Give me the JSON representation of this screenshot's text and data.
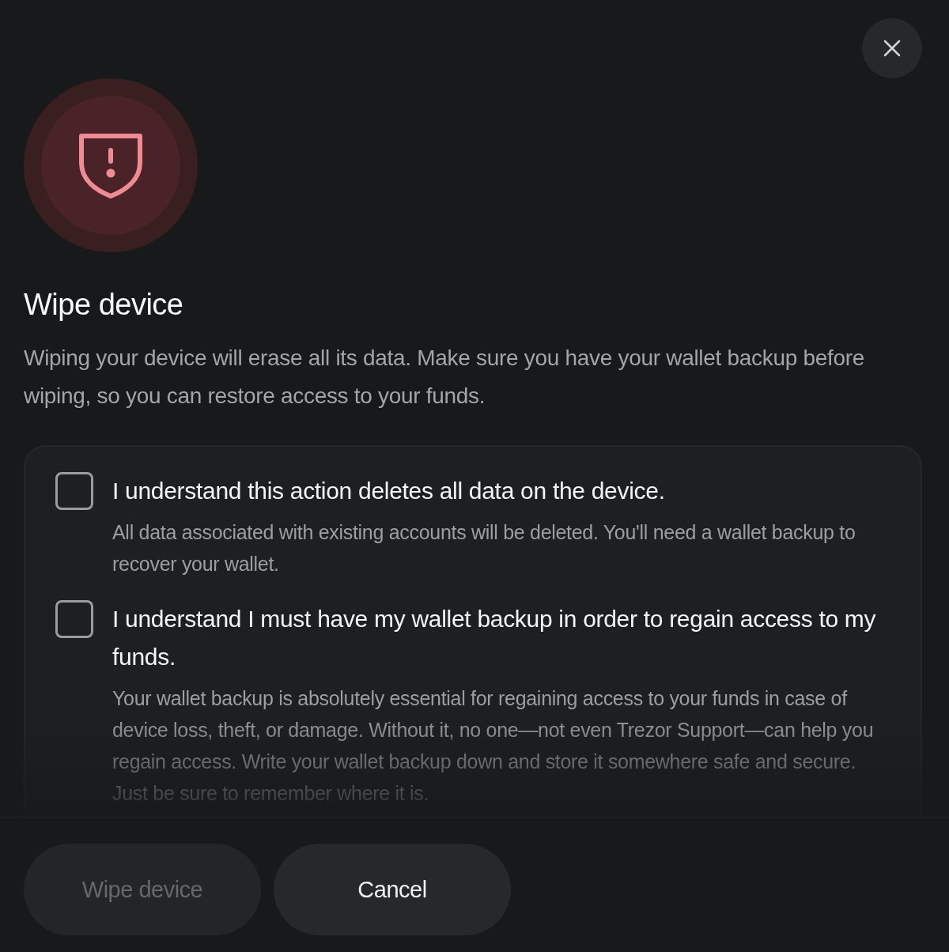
{
  "title": "Wipe device",
  "description": "Wiping your device will erase all its data. Make sure you have your wallet backup before wiping, so you can restore access to your funds.",
  "checks": [
    {
      "label": "I understand this action deletes all data on the device.",
      "detail": "All data associated with existing accounts will be deleted. You'll need a wallet backup to recover your wallet.",
      "checked": false
    },
    {
      "label": "I understand I must have my wallet backup in order to regain access to my funds.",
      "detail": "Your wallet backup is absolutely essential for regaining access to your funds in case of device loss, theft, or damage. Without it, no one—not even Trezor Support—can help you regain access. Write your wallet backup down and store it somewhere safe and secure. Just be sure to remember where it is.",
      "checked": false
    }
  ],
  "buttons": [
    {
      "label": "Wipe device",
      "kind": "primary",
      "disabled": true
    },
    {
      "label": "Cancel",
      "kind": "secondary",
      "disabled": false
    }
  ]
}
